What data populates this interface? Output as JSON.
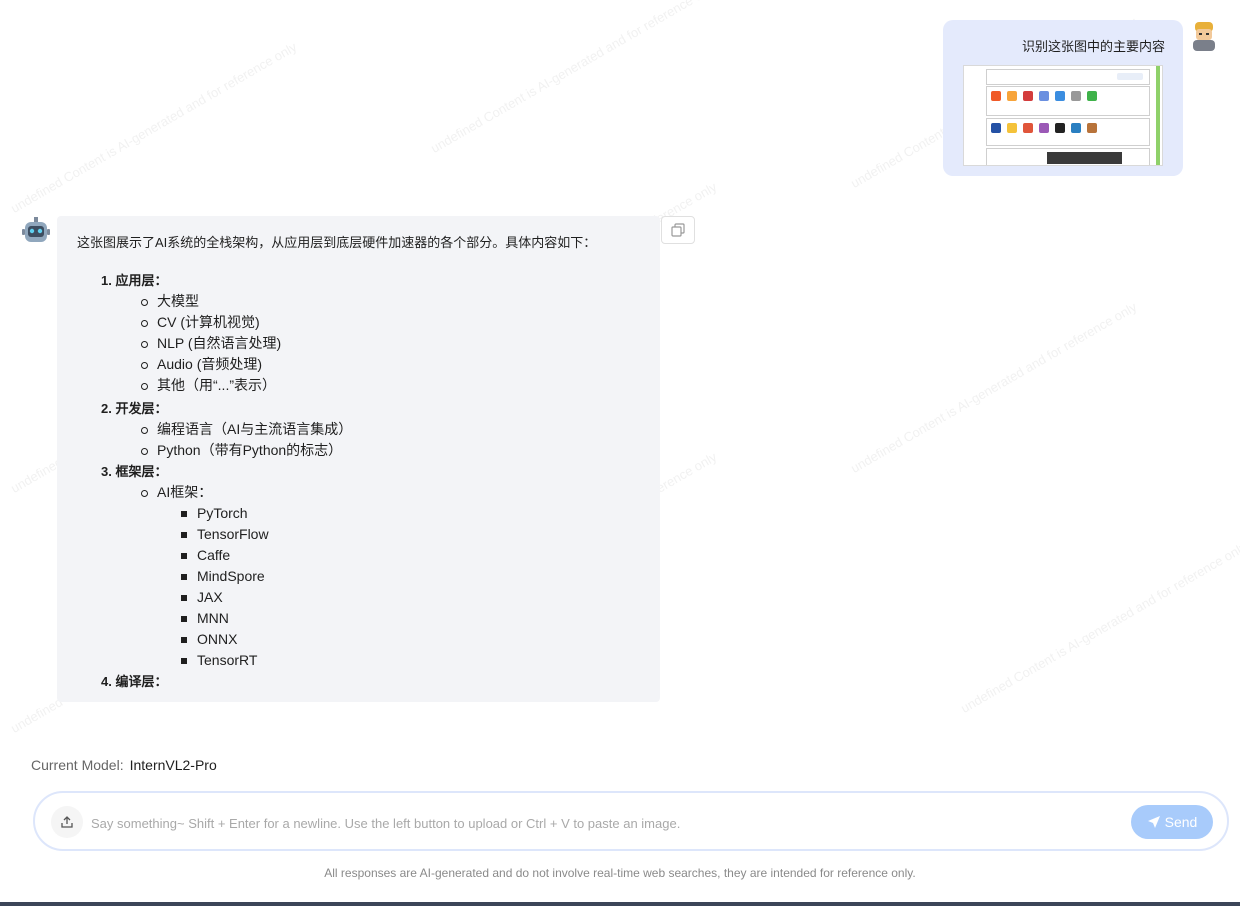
{
  "watermark_text": "undefined Content is AI-generated and for reference only",
  "user_message": {
    "text": "识别这张图中的主要内容"
  },
  "assistant_message": {
    "intro": "这张图展示了AI系统的全栈架构，从应用层到底层硬件加速器的各个部分。具体内容如下：",
    "sections": [
      {
        "title": "1. 应用层：",
        "items": [
          "大模型",
          "CV (计算机视觉)",
          "NLP (自然语言处理)",
          "Audio (音频处理)",
          "其他（用“...”表示）"
        ]
      },
      {
        "title": "2. 开发层：",
        "items": [
          "编程语言（AI与主流语言集成）",
          "Python（带有Python的标志）"
        ]
      },
      {
        "title": "3. 框架层：",
        "items": [
          "AI框架："
        ],
        "subitems": [
          "PyTorch",
          "TensorFlow",
          "Caffe",
          "MindSpore",
          "JAX",
          "MNN",
          "ONNX",
          "TensorRT"
        ]
      },
      {
        "title": "4. 编译层：",
        "items": []
      }
    ]
  },
  "current_model": {
    "label": "Current Model:",
    "name": "InternVL2-Pro"
  },
  "input": {
    "placeholder": "Say something~ Shift + Enter for a newline. Use the left button to upload or Ctrl + V to paste an image.",
    "send_label": "Send"
  },
  "disclaimer": "All responses are AI-generated and do not involve real-time web searches, they are intended for reference only.",
  "colors": {
    "user_bubble": "#e4eafc",
    "bot_bubble": "#f3f4f7",
    "send_button": "#a8cbfb",
    "input_border": "#dde6fb"
  }
}
